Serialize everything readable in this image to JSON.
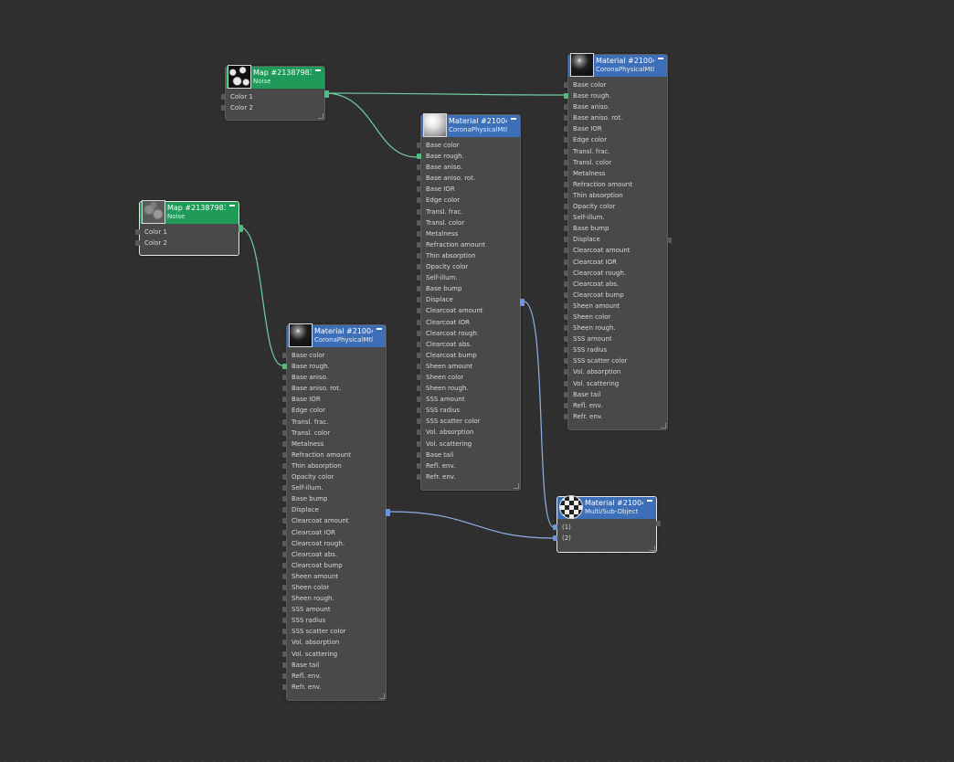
{
  "colors": {
    "map_header": "#1f9a58",
    "material_header": "#3d6fb8",
    "wire_map": "#6fcfa0",
    "wire_material": "#8fb0e6",
    "canvas": "#2f2f2f"
  },
  "nodes": {
    "map1": {
      "title": "Map #21387983...",
      "subtitle": "Noise",
      "slots": [
        "Color 1",
        "Color 2"
      ]
    },
    "map2": {
      "title": "Map #2138798316",
      "subtitle": "Noise",
      "slots": [
        "Color 1",
        "Color 2"
      ]
    },
    "mat_top": {
      "title": "Material #21004...",
      "subtitle": "CoronaPhysicalMtl",
      "slots": [
        "Base color",
        "Base rough.",
        "Base aniso.",
        "Base aniso. rot.",
        "Base IOR",
        "Edge color",
        "Transl. frac.",
        "Transl. color",
        "Metalness",
        "Refraction amount",
        "Thin absorption",
        "Opacity color",
        "Self-illum.",
        "Base bump",
        "Displace",
        "Clearcoat amount",
        "Clearcoat IOR",
        "Clearcoat rough.",
        "Clearcoat abs.",
        "Clearcoat bump",
        "Sheen amount",
        "Sheen color",
        "Sheen rough.",
        "SSS amount",
        "SSS radius",
        "SSS scatter color",
        "Vol. absorption",
        "Vol. scattering",
        "Base tail",
        "Refl. env.",
        "Refr. env."
      ]
    },
    "mat_mid": {
      "title": "Material #21004...",
      "subtitle": "CoronaPhysicalMtl",
      "slots": [
        "Base color",
        "Base rough.",
        "Base aniso.",
        "Base aniso. rot.",
        "Base IOR",
        "Edge color",
        "Transl. frac.",
        "Transl. color",
        "Metalness",
        "Refraction amount",
        "Thin absorption",
        "Opacity color",
        "Self-illum.",
        "Base bump",
        "Displace",
        "Clearcoat amount",
        "Clearcoat IOR",
        "Clearcoat rough.",
        "Clearcoat abs.",
        "Clearcoat bump",
        "Sheen amount",
        "Sheen color",
        "Sheen rough.",
        "SSS amount",
        "SSS radius",
        "SSS scatter color",
        "Vol. absorption",
        "Vol. scattering",
        "Base tail",
        "Refl. env.",
        "Refr. env."
      ]
    },
    "mat_bottom": {
      "title": "Material #21004...",
      "subtitle": "CoronaPhysicalMtl",
      "slots": [
        "Base color",
        "Base rough.",
        "Base aniso.",
        "Base aniso. rot.",
        "Base IOR",
        "Edge color",
        "Transl. frac.",
        "Transl. color",
        "Metalness",
        "Refraction amount",
        "Thin absorption",
        "Opacity color",
        "Self-illum.",
        "Base bump",
        "Displace",
        "Clearcoat amount",
        "Clearcoat IOR",
        "Clearcoat rough.",
        "Clearcoat abs.",
        "Clearcoat bump",
        "Sheen amount",
        "Sheen color",
        "Sheen rough.",
        "SSS amount",
        "SSS radius",
        "SSS scatter color",
        "Vol. absorption",
        "Vol. scattering",
        "Base tail",
        "Refl. env.",
        "Refr. env."
      ]
    },
    "multi": {
      "title": "Material #21004...",
      "subtitle": "Multi/Sub-Object",
      "slots": [
        "(1)",
        "(2)"
      ]
    }
  },
  "connections": [
    {
      "from": "map1",
      "to": "mat_top",
      "slot": "Base rough."
    },
    {
      "from": "map1",
      "to": "mat_mid",
      "slot": "Base rough."
    },
    {
      "from": "map2",
      "to": "mat_bottom",
      "slot": "Base rough."
    },
    {
      "from": "mat_mid",
      "to": "multi",
      "slot": "(1)"
    },
    {
      "from": "mat_bottom",
      "to": "multi",
      "slot": "(2)"
    }
  ]
}
